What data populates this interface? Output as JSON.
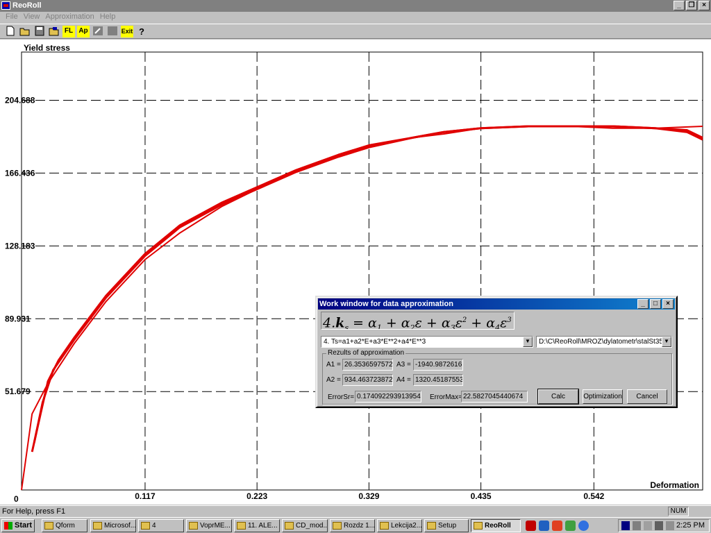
{
  "app": {
    "title": "ReoRoll"
  },
  "menu": [
    "File",
    "View",
    "Approximation",
    "Help"
  ],
  "toolbar": {
    "fl_label": "FL",
    "ap_label": "Ap",
    "exit_label": "Exit"
  },
  "chart_data": {
    "type": "line",
    "ylabel": "Yield stress",
    "xlabel": "Deformation",
    "origin_label": "0",
    "xticks": [
      "0.117",
      "0.223",
      "0.329",
      "0.435",
      "0.542"
    ],
    "yticks": [
      "204.688",
      "166.436",
      "128.183",
      "89.931",
      "51.679"
    ],
    "xlim": [
      0,
      0.645
    ],
    "ylim": [
      0,
      230
    ],
    "grid": true,
    "color": "#e00000",
    "series": [
      {
        "x": [
          0,
          0.01,
          0.025,
          0.05,
          0.08,
          0.117,
          0.15,
          0.19,
          0.223,
          0.26,
          0.3,
          0.329,
          0.37,
          0.4,
          0.435,
          0.48,
          0.52,
          0.56,
          0.6,
          0.645
        ],
        "y": [
          0,
          40,
          56,
          77,
          99,
          121,
          135,
          149,
          158,
          167,
          175,
          180,
          185,
          187,
          190,
          191,
          191,
          190,
          190,
          191
        ]
      },
      {
        "x": [
          0.01,
          0.018,
          0.025,
          0.035,
          0.05,
          0.08,
          0.117,
          0.15,
          0.19,
          0.223,
          0.26,
          0.3,
          0.329,
          0.37,
          0.4,
          0.435,
          0.48,
          0.52,
          0.56,
          0.6,
          0.63,
          0.645
        ],
        "y": [
          20,
          40,
          57,
          68,
          80,
          102,
          124,
          139,
          151,
          159,
          168,
          176,
          181,
          185,
          188,
          190,
          191,
          191,
          191,
          190,
          188,
          184
        ]
      },
      {
        "x": [
          0.012,
          0.02,
          0.03,
          0.05,
          0.08,
          0.117,
          0.15,
          0.19,
          0.223,
          0.26,
          0.3,
          0.329,
          0.37,
          0.4,
          0.435,
          0.48,
          0.52,
          0.56,
          0.6,
          0.63,
          0.645
        ],
        "y": [
          25,
          46,
          63,
          79,
          101,
          123,
          138,
          150,
          158,
          167,
          175,
          180,
          185,
          188,
          190,
          191,
          191,
          191,
          190,
          189,
          185
        ]
      }
    ]
  },
  "dialog": {
    "title": "Work window for data approximation",
    "formula": "4.k_s = a1 + a2 e + a3 e^2 + a4 e^3",
    "function_select": "4. Ts=a1+a2*E+a3*E**2+a4*E**3",
    "file_select": "D:\\C\\ReoRoll\\MROZ\\dylatometr\\stalSt35",
    "group_label": "Rezults of approximation",
    "a1_label": "A1 =",
    "a1": "26.3536597572",
    "a2_label": "A2 =",
    "a2": "934.463723872",
    "a3_label": "A3 =",
    "a3": "-1940.9872616",
    "a4_label": "A4 =",
    "a4": "1320.45187553",
    "error_sr_label": "ErrorSr=",
    "error_sr": "0.174092293913954",
    "error_max_label": "ErrorMax=",
    "error_max": "22.5827045440674",
    "calc": "Calc",
    "optimization": "Optimization",
    "cancel": "Cancel"
  },
  "status": {
    "help": "For Help, press F1",
    "num": "NUM"
  },
  "taskbar": {
    "start": "Start",
    "tasks": [
      "Qform",
      "Microsof...",
      "4",
      "VoprME...",
      "11. ALE...",
      "CD_mod...",
      "Rozdz 1...",
      "Lekcija2...",
      "Setup",
      "ReoRoll"
    ],
    "clock": "2:25 PM"
  }
}
